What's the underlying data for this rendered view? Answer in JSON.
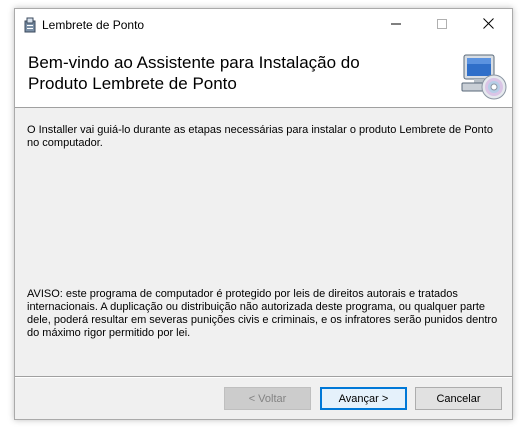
{
  "window": {
    "title": "Lembrete de Ponto",
    "icons": {
      "app": "installer-app-icon",
      "minimize": "minimize-icon",
      "maximize": "maximize-icon",
      "close": "close-icon"
    }
  },
  "header": {
    "title": "Bem-vindo ao Assistente para Instalação do Produto Lembrete de Ponto",
    "graphic": "computer-cd-icon"
  },
  "content": {
    "intro": "O Installer vai guiá-lo durante as etapas necessárias para instalar o produto Lembrete de Ponto no computador.",
    "warning": "AVISO: este programa de computador é protegido por leis de direitos autorais e tratados internacionais. A duplicação ou distribuição não autorizada deste programa, ou qualquer parte dele, poderá resultar em severas punições civis e criminais, e os infratores serão punidos dentro do máximo rigor permitido por lei."
  },
  "buttons": {
    "back": "< Voltar",
    "next": "Avançar >",
    "cancel": "Cancelar"
  },
  "colors": {
    "accent": "#0078d7",
    "panel": "#f0f0f0",
    "header_bg": "#ffffff",
    "disabled_text": "#838383"
  }
}
